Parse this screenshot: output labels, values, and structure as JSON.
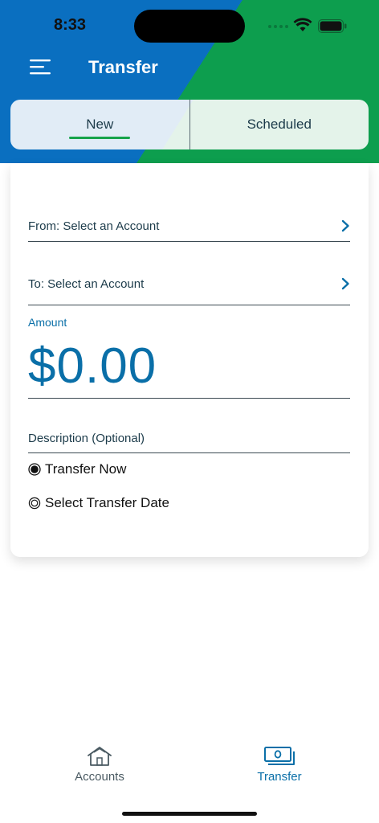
{
  "status_bar": {
    "time": "8:33"
  },
  "header": {
    "title": "Transfer",
    "menu_icon": "hamburger-menu-icon"
  },
  "tabs": [
    {
      "label": "New",
      "active": true
    },
    {
      "label": "Scheduled",
      "active": false
    }
  ],
  "form": {
    "from_label": "From: Select an Account",
    "to_label": "To: Select an Account",
    "amount_label": "Amount",
    "amount_value": "$0.00",
    "description_placeholder": "Description (Optional)",
    "radio_options": [
      {
        "label": "Transfer Now",
        "selected": true
      },
      {
        "label": "Select Transfer Date",
        "selected": false
      }
    ]
  },
  "bottom_nav": [
    {
      "label": "Accounts",
      "icon": "home-icon",
      "active": false
    },
    {
      "label": "Transfer",
      "icon": "money-transfer-icon",
      "active": true
    }
  ],
  "colors": {
    "header_blue": "#0a6fc0",
    "header_green": "#0d9e4e",
    "accent": "#0a6fa8",
    "tab_underline": "#16a34a"
  }
}
